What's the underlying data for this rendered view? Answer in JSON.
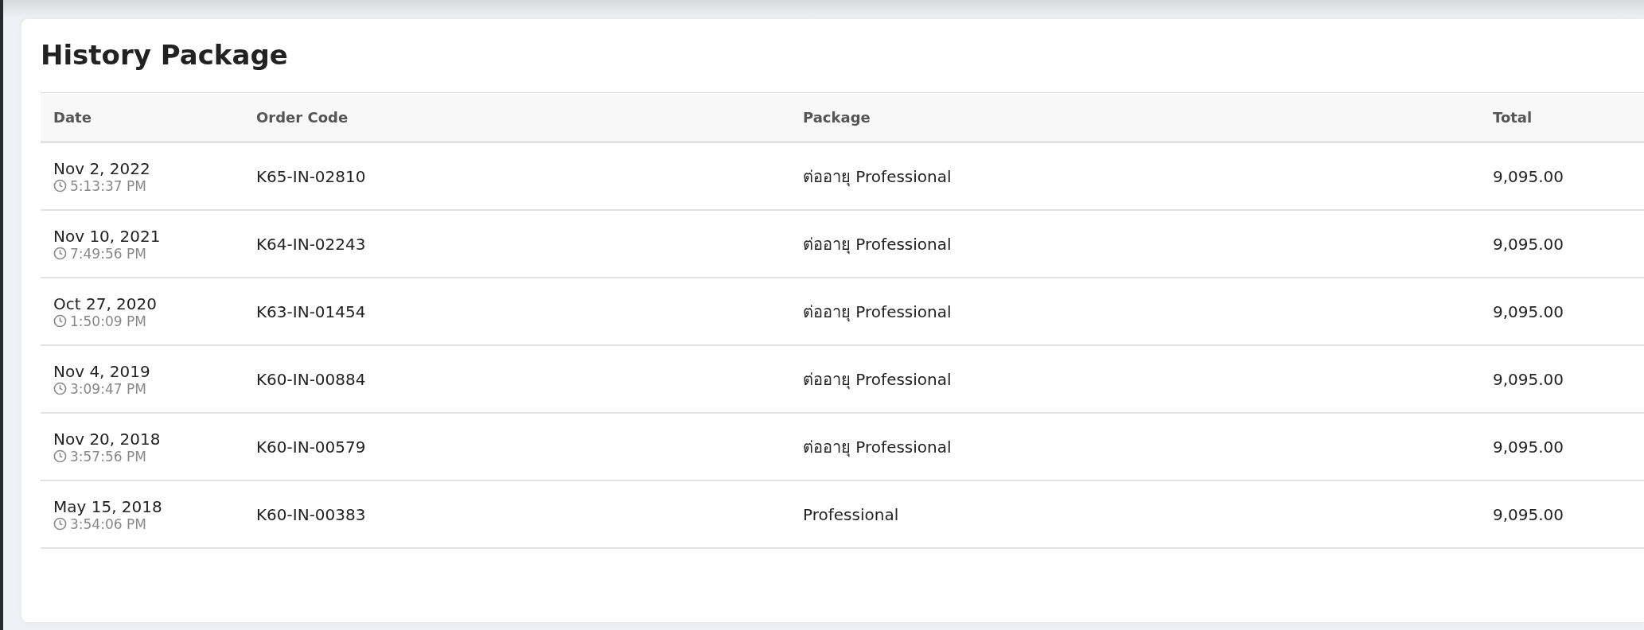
{
  "title": "History Package",
  "table": {
    "columns": [
      "Date",
      "Order Code",
      "Package",
      "Total"
    ],
    "rows": [
      {
        "date": "Nov 2, 2022",
        "time": "5:13:37 PM",
        "order_code": "K65-IN-02810",
        "package": "ต่ออายุ Professional",
        "total": "9,095.00"
      },
      {
        "date": "Nov 10, 2021",
        "time": "7:49:56 PM",
        "order_code": "K64-IN-02243",
        "package": "ต่ออายุ Professional",
        "total": "9,095.00"
      },
      {
        "date": "Oct 27, 2020",
        "time": "1:50:09 PM",
        "order_code": "K63-IN-01454",
        "package": "ต่ออายุ Professional",
        "total": "9,095.00"
      },
      {
        "date": "Nov 4, 2019",
        "time": "3:09:47 PM",
        "order_code": "K60-IN-00884",
        "package": "ต่ออายุ Professional",
        "total": "9,095.00"
      },
      {
        "date": "Nov 20, 2018",
        "time": "3:57:56 PM",
        "order_code": "K60-IN-00579",
        "package": "ต่ออายุ Professional",
        "total": "9,095.00"
      },
      {
        "date": "May 15, 2018",
        "time": "3:54:06 PM",
        "order_code": "K60-IN-00383",
        "package": "Professional",
        "total": "9,095.00"
      }
    ]
  }
}
